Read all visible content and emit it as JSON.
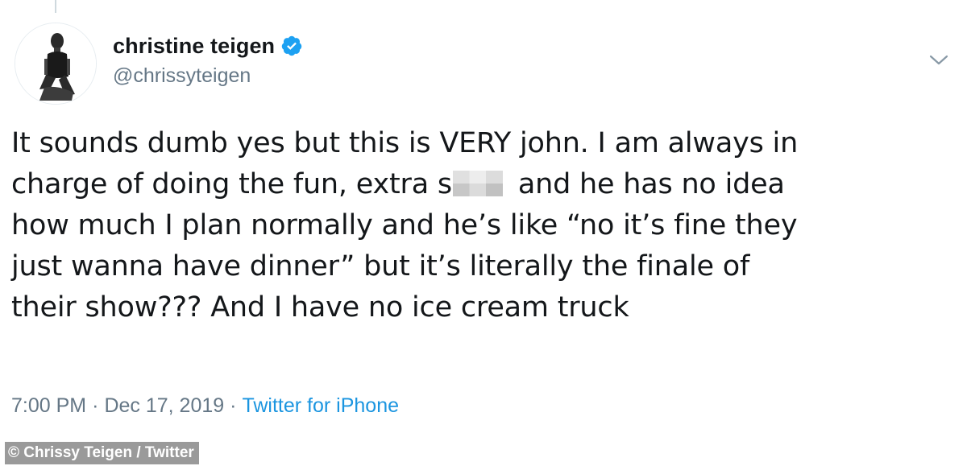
{
  "tweet": {
    "display_name": "christine teigen",
    "handle": "@chrissyteigen",
    "text_lines": [
      "It sounds dumb yes but this is VERY john. I am always in",
      "charge of doing the fun, extra s",
      " and he has no idea",
      "how much I plan normally and he’s like “no it’s fine they",
      "just wanna have dinner” but it’s literally the finale of",
      "their show??? And I have no ice cream truck"
    ],
    "time": "7:00 PM",
    "date": "Dec 17, 2019",
    "separator": "·",
    "source": "Twitter for iPhone"
  },
  "credit": "© Chrissy Teigen / Twitter",
  "icons": {
    "verified": "verified-badge-icon",
    "menu": "chevron-down-icon"
  },
  "colors": {
    "name": "#14171a",
    "secondary": "#657786",
    "link": "#1b95e0",
    "verified": "#1da1f2"
  }
}
